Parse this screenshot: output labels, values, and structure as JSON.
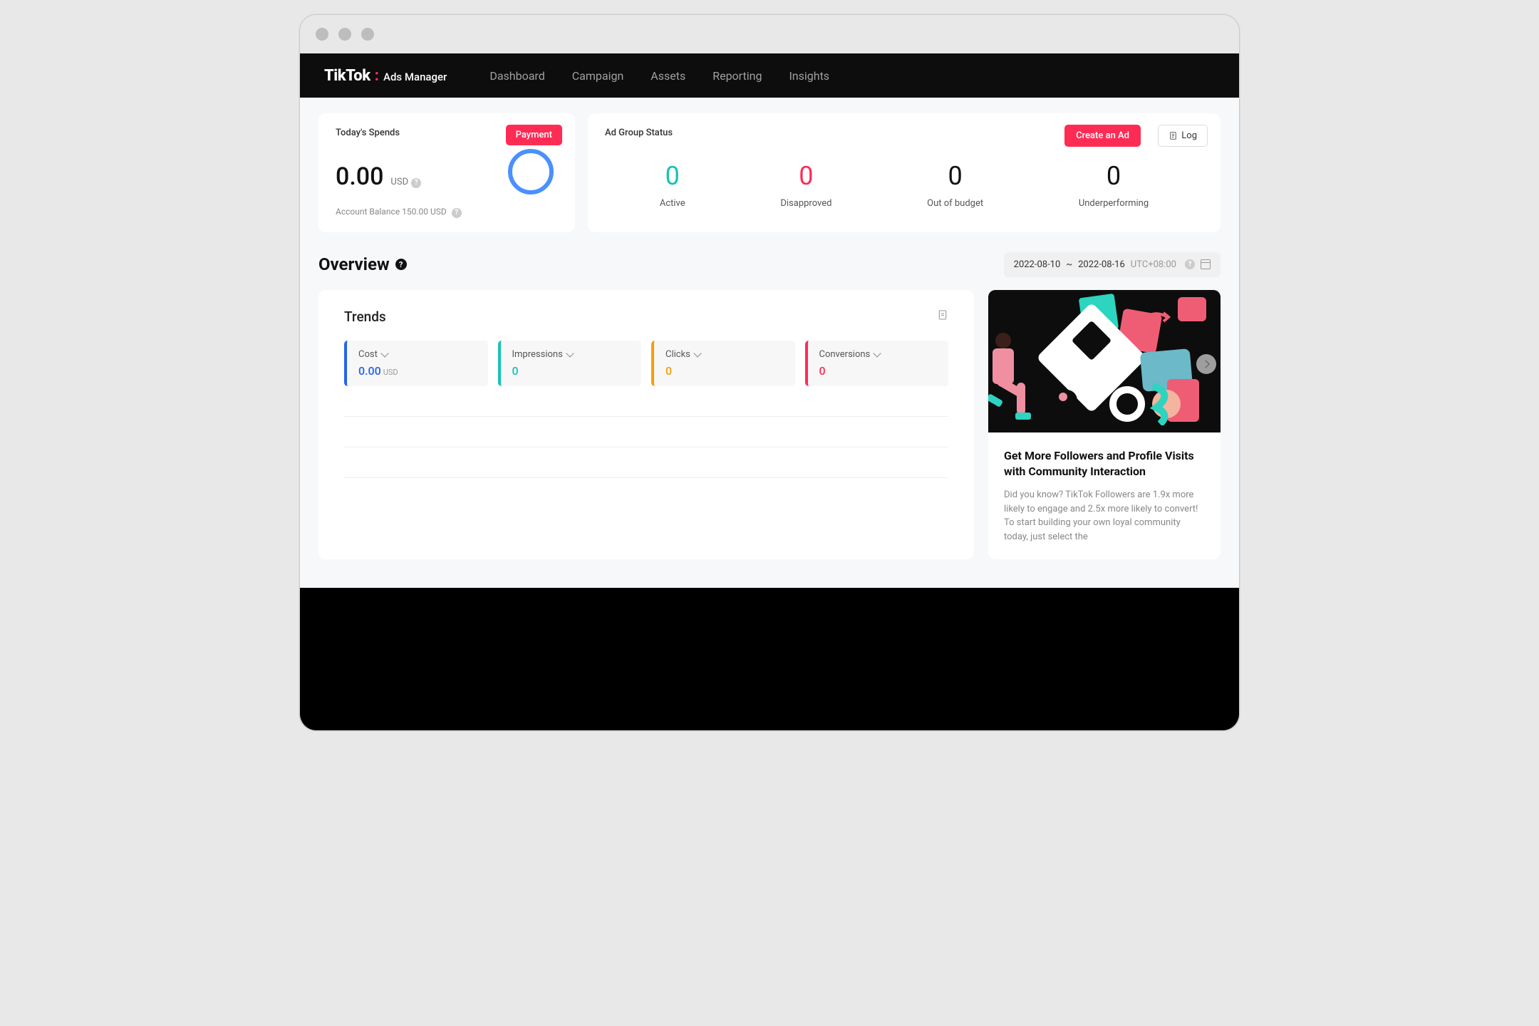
{
  "brand": {
    "main": "TikTok",
    "sub": "Ads Manager"
  },
  "nav": {
    "dashboard": "Dashboard",
    "campaign": "Campaign",
    "assets": "Assets",
    "reporting": "Reporting",
    "insights": "Insights"
  },
  "spends": {
    "title": "Today's Spends",
    "payment_btn": "Payment",
    "amount": "0.00",
    "currency": "USD",
    "balance": "Account Balance 150.00 USD"
  },
  "status": {
    "title": "Ad Group Status",
    "create_btn": "Create an Ad",
    "log_btn": "Log",
    "items": {
      "active": {
        "value": "0",
        "label": "Active"
      },
      "disapproved": {
        "value": "0",
        "label": "Disapproved"
      },
      "outofbudget": {
        "value": "0",
        "label": "Out of budget"
      },
      "underperforming": {
        "value": "0",
        "label": "Underperforming"
      }
    }
  },
  "overview": {
    "title": "Overview",
    "date_from": "2022-08-10",
    "date_to": "2022-08-16",
    "timezone": "UTC+08:00"
  },
  "trends": {
    "title": "Trends",
    "cost": {
      "label": "Cost",
      "value": "0.00",
      "unit": "USD"
    },
    "impressions": {
      "label": "Impressions",
      "value": "0"
    },
    "clicks": {
      "label": "Clicks",
      "value": "0"
    },
    "conversions": {
      "label": "Conversions",
      "value": "0"
    }
  },
  "promo": {
    "title": "Get More Followers and Profile Visits with Community Interaction",
    "body": "Did you know? TikTok Followers are 1.9x more likely to engage and 2.5x more likely to convert! To start building your own loyal community today, just select the"
  },
  "date_sep": "~"
}
